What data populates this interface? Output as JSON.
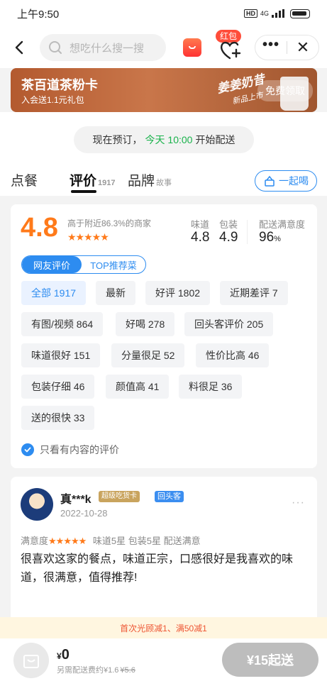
{
  "status": {
    "time": "上午9:50",
    "hd": "HD",
    "network": "4G"
  },
  "header": {
    "search_placeholder": "想吃什么搜一搜",
    "redpacket_badge": "红包",
    "more": "•••",
    "close": "✕"
  },
  "banner": {
    "title": "茶百道茶粉卡",
    "subtitle": "入会送1.1元礼包",
    "deco": "姜姜奶昔",
    "deco2": "新品上市",
    "button": "免费领取"
  },
  "delivery": {
    "prefix": "现在预订，",
    "time": "今天 10:00",
    "suffix": "开始配送"
  },
  "tabs": [
    {
      "label": "点餐",
      "count": ""
    },
    {
      "label": "评价",
      "count": "1917"
    },
    {
      "label": "品牌",
      "count": "故事"
    }
  ],
  "drink_together": "一起喝",
  "rating": {
    "score": "4.8",
    "desc": "高于附近86.3%的商家",
    "stars": "★★★★★",
    "metrics": [
      {
        "label": "味道",
        "value": "4.8"
      },
      {
        "label": "包装",
        "value": "4.9"
      },
      {
        "label": "配送满意度",
        "value": "96",
        "unit": "%"
      }
    ],
    "segments": [
      "网友评价",
      "TOP推荐菜"
    ],
    "chips": [
      "全部 1917",
      "最新",
      "好评 1802",
      "近期差评 7",
      "有图/视频 864",
      "好喝 278",
      "回头客评价 205",
      "味道很好 151",
      "分量很足 52",
      "性价比高 46",
      "包装仔细 46",
      "颜值高 41",
      "料很足 36",
      "送的很快 33"
    ],
    "only_content": "只看有内容的评价"
  },
  "review": {
    "name": "真***k",
    "badge_gold": "超级吃货卡",
    "badge_blue": "回头客",
    "date": "2022-10-28",
    "more": "···",
    "meta_label": "满意度",
    "meta_stars": "★★★★★",
    "meta_rest": "味道5星   包装5星   配送满意",
    "text": "很喜欢这家的餐点，味道正宗，口感很好是我喜欢的味道，很满意，值得推荐!"
  },
  "promo": "首次光顾减1、满50减1",
  "bottom": {
    "currency": "¥",
    "amount": "0",
    "fee_label": "另需配送费约¥1.6",
    "fee_orig": "¥5.6",
    "go": "¥15起送"
  }
}
